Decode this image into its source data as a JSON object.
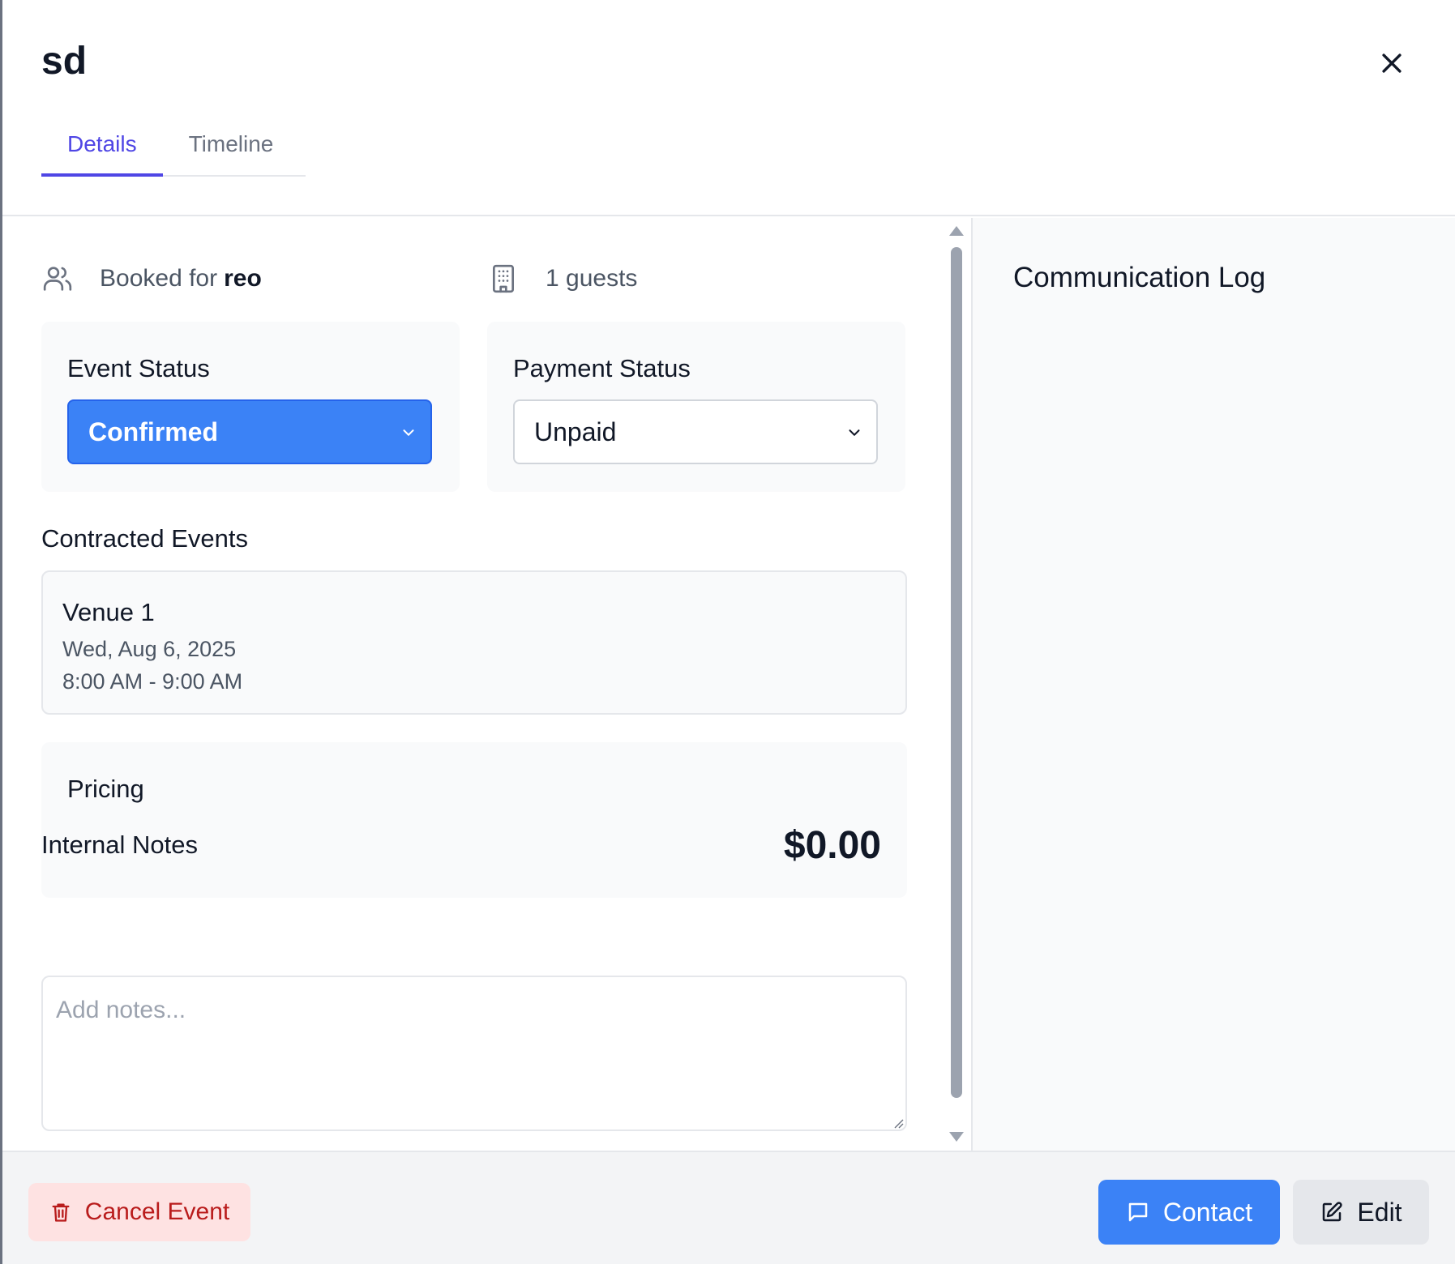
{
  "modal": {
    "title": "sd",
    "close_icon": "close-icon"
  },
  "tabs": [
    {
      "label": "Details",
      "active": true
    },
    {
      "label": "Timeline",
      "active": false
    }
  ],
  "info": {
    "booked_prefix": "Booked for",
    "booked_name": "reo",
    "guests": "1 guests",
    "booked_icon": "users-icon",
    "guests_icon": "building-icon"
  },
  "event_status": {
    "label": "Event Status",
    "value": "Confirmed",
    "color": "#3b82f6"
  },
  "payment_status": {
    "label": "Payment Status",
    "value": "Unpaid"
  },
  "contracted_events": {
    "heading": "Contracted Events",
    "items": [
      {
        "venue": "Venue 1",
        "date": "Wed, Aug 6, 2025",
        "time": "8:00 AM - 9:00 AM"
      }
    ]
  },
  "pricing": {
    "label": "Pricing",
    "total": "$0.00"
  },
  "notes": {
    "heading": "Internal Notes",
    "placeholder": "Add notes...",
    "value": ""
  },
  "communication_log": {
    "title": "Communication Log"
  },
  "footer": {
    "cancel_label": "Cancel Event",
    "contact_label": "Contact",
    "edit_label": "Edit"
  },
  "colors": {
    "accent": "#4f46e5",
    "primary": "#3b82f6",
    "danger_bg": "#fee2e2",
    "danger_text": "#b91c1c"
  }
}
